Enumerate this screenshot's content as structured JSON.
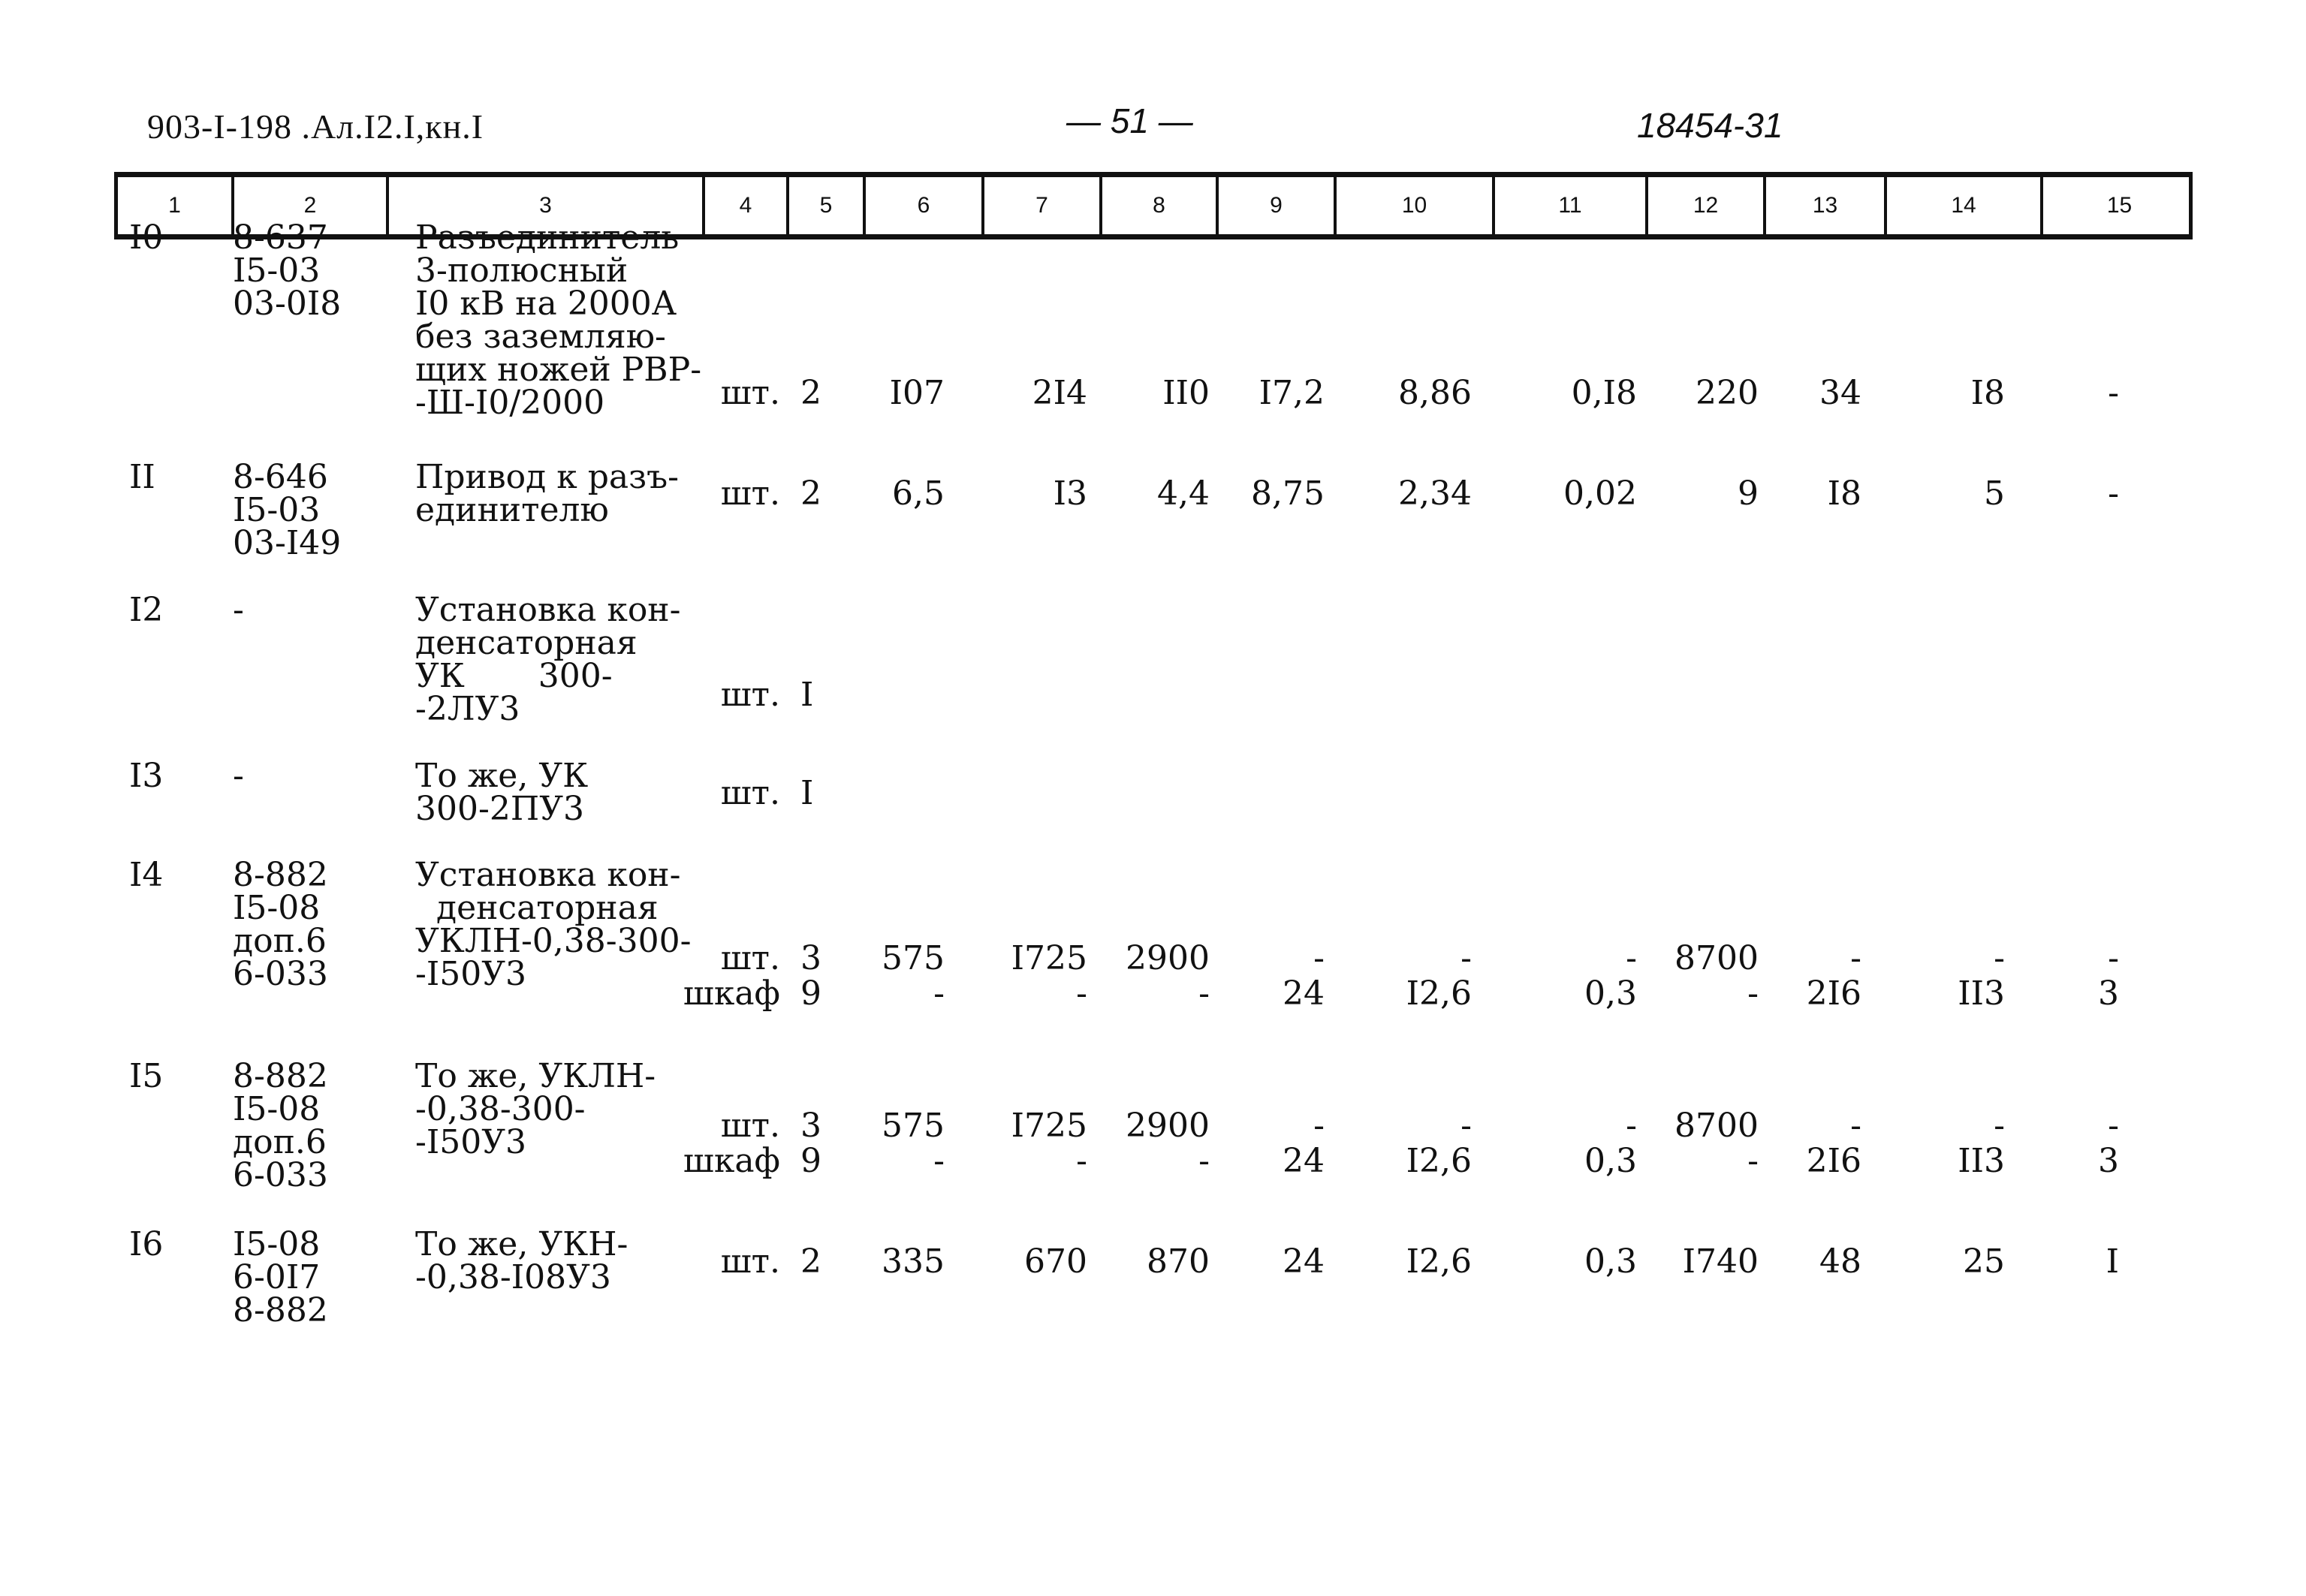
{
  "header": {
    "doc_code": "903-I-198 .Ал.I2.I,кн.I",
    "page_number": "— 51 —",
    "sheet_code": "18454-31"
  },
  "columns": [
    "1",
    "2",
    "3",
    "4",
    "5",
    "6",
    "7",
    "8",
    "9",
    "10",
    "11",
    "12",
    "13",
    "14",
    "15"
  ],
  "rows": [
    {
      "num": "I0",
      "codes": [
        "8-637",
        "I5-03",
        "03-0I8"
      ],
      "name": [
        "Разъединитель",
        "3-полюсный",
        "I0 кВ на 2000А",
        "без заземляю-",
        "щих ножей РВР-",
        "-Ш-I0/2000"
      ],
      "lines": [
        {
          "unit": "шт.",
          "qty": "2",
          "c6": "I07",
          "c7": "2I4",
          "c8": "II0",
          "c9": "I7,2",
          "c10": "8,86",
          "c11": "0,I8",
          "c12": "220",
          "c13": "34",
          "c14": "I8",
          "c15": "-"
        }
      ]
    },
    {
      "num": "II",
      "codes": [
        "8-646",
        "I5-03",
        "03-I49"
      ],
      "name": [
        "Привод к разъ-",
        "единителю"
      ],
      "lines": [
        {
          "unit": "шт.",
          "qty": "2",
          "c6": "6,5",
          "c7": "I3",
          "c8": "4,4",
          "c9": "8,75",
          "c10": "2,34",
          "c11": "0,02",
          "c12": "9",
          "c13": "I8",
          "c14": "5",
          "c15": "-"
        }
      ]
    },
    {
      "num": "I2",
      "codes": [
        "-"
      ],
      "name": [
        "Установка кон-",
        "денсаторная",
        "УК       300-",
        "-2ЛУ3"
      ],
      "lines": [
        {
          "unit": "шт.",
          "qty": "I",
          "c6": "",
          "c7": "",
          "c8": "",
          "c9": "",
          "c10": "",
          "c11": "",
          "c12": "",
          "c13": "",
          "c14": "",
          "c15": ""
        }
      ]
    },
    {
      "num": "I3",
      "codes": [
        "-"
      ],
      "name": [
        "То же, УК",
        "300-2ПУ3"
      ],
      "lines": [
        {
          "unit": "шт.",
          "qty": "I",
          "c6": "",
          "c7": "",
          "c8": "",
          "c9": "",
          "c10": "",
          "c11": "",
          "c12": "",
          "c13": "",
          "c14": "",
          "c15": ""
        }
      ]
    },
    {
      "num": "I4",
      "codes": [
        "8-882",
        "I5-08",
        "доп.6",
        "6-033"
      ],
      "name": [
        "Установка кон-",
        "  денсаторная",
        "УКЛН-0,38-300-",
        "-I50У3"
      ],
      "lines": [
        {
          "unit": "шт.",
          "qty": "3",
          "c6": "575",
          "c7": "I725",
          "c8": "2900",
          "c9": "-",
          "c10": "-",
          "c11": "-",
          "c12": "8700",
          "c13": "-",
          "c14": "-",
          "c15": "-"
        },
        {
          "unit": "шкаф",
          "qty": "9",
          "c6": "-",
          "c7": "-",
          "c8": "-",
          "c9": "24",
          "c10": "I2,6",
          "c11": "0,3",
          "c12": "-",
          "c13": "2I6",
          "c14": "II3",
          "c15": "3"
        }
      ]
    },
    {
      "num": "I5",
      "codes": [
        "8-882",
        "I5-08",
        "доп.6",
        "6-033"
      ],
      "name": [
        "То же, УКЛН-",
        "-0,38-300-",
        "-I50У3"
      ],
      "lines": [
        {
          "unit": "шт.",
          "qty": "3",
          "c6": "575",
          "c7": "I725",
          "c8": "2900",
          "c9": "-",
          "c10": "-",
          "c11": "-",
          "c12": "8700",
          "c13": "-",
          "c14": "-",
          "c15": "-"
        },
        {
          "unit": "шкаф",
          "qty": "9",
          "c6": "-",
          "c7": "-",
          "c8": "-",
          "c9": "24",
          "c10": "I2,6",
          "c11": "0,3",
          "c12": "-",
          "c13": "2I6",
          "c14": "II3",
          "c15": "3"
        }
      ]
    },
    {
      "num": "I6",
      "codes": [
        "I5-08",
        "6-0I7",
        "8-882"
      ],
      "name": [
        "То же, УКН-",
        "-0,38-I08У3"
      ],
      "lines": [
        {
          "unit": "шт.",
          "qty": "2",
          "c6": "335",
          "c7": "670",
          "c8": "870",
          "c9": "24",
          "c10": "I2,6",
          "c11": "0,3",
          "c12": "I740",
          "c13": "48",
          "c14": "25",
          "c15": "I"
        }
      ]
    }
  ]
}
